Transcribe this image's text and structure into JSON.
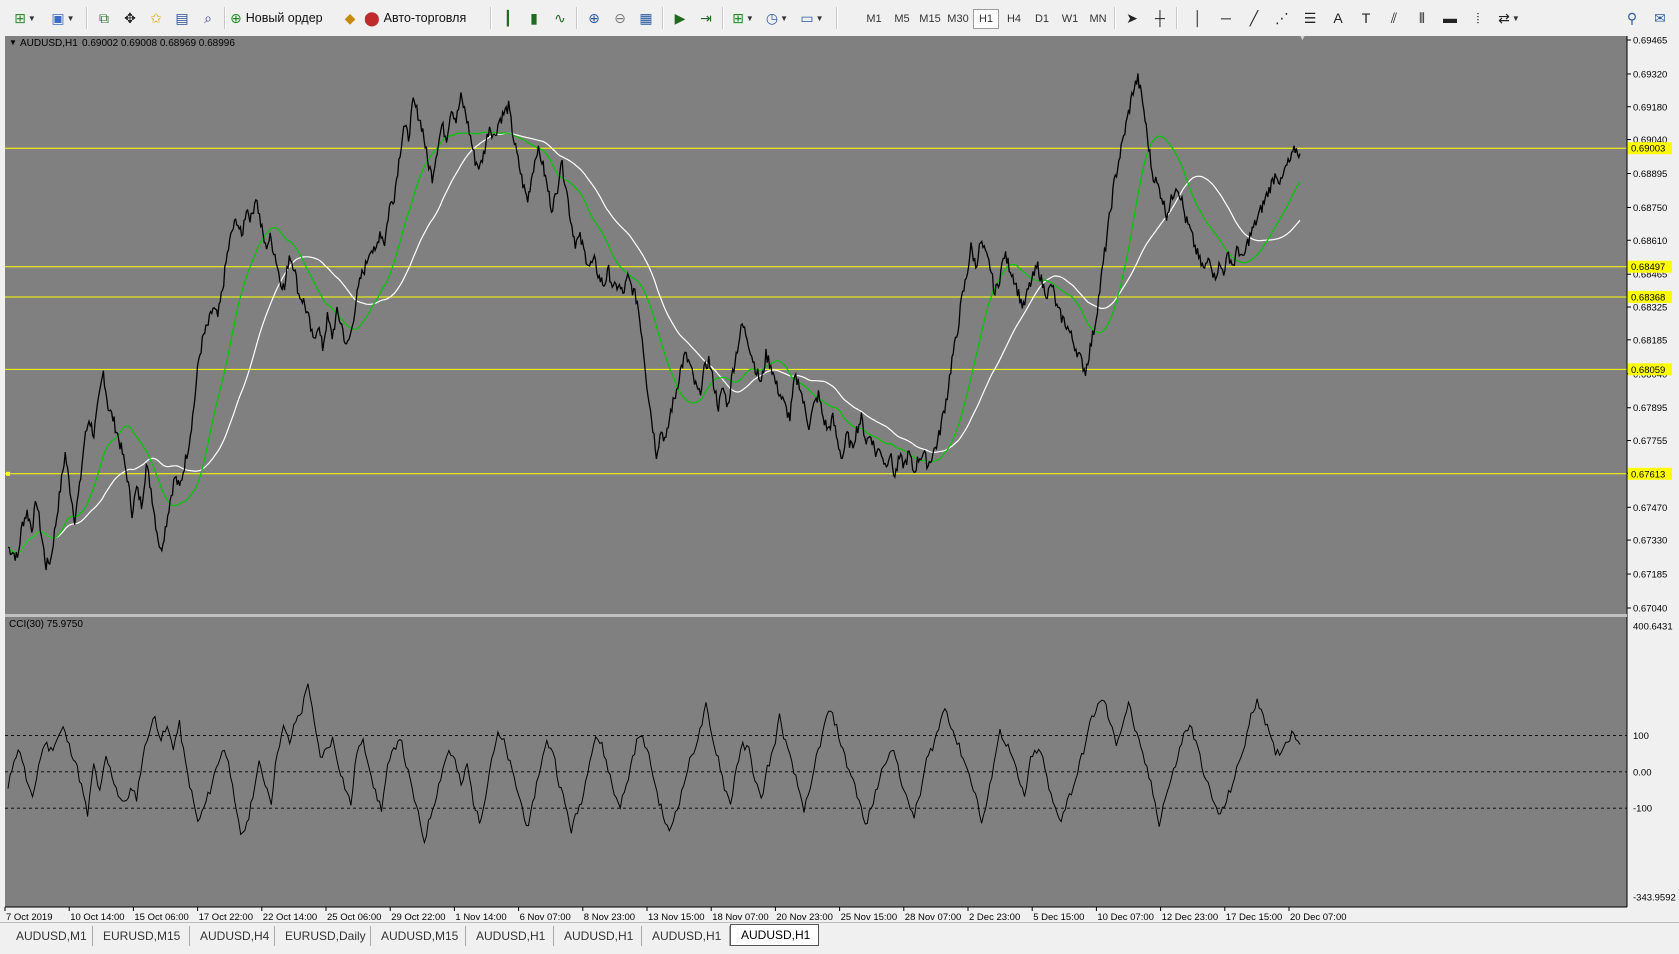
{
  "toolbar": {
    "new_order_label": "Новый ордер",
    "autotrading_label": "Авто-торговля",
    "timeframes": [
      "M1",
      "M5",
      "M15",
      "M30",
      "H1",
      "H4",
      "D1",
      "W1",
      "MN"
    ],
    "active_timeframe": "H1"
  },
  "chart": {
    "header_label": "AUDUSD,H1",
    "header_ohlc": "0.69002 0.69008 0.68969 0.68996",
    "indicator_label": "CCI(30) 75.9750",
    "colors": {
      "background": "#808080",
      "price": "#000000",
      "ma_fast": "#00c800",
      "ma_slow": "#ffffff",
      "level_line": "#ffff00",
      "level_label_bg": "#ffff00",
      "axis_text": "#000000"
    }
  },
  "chart_data": [
    {
      "type": "line",
      "title": "AUDUSD,H1",
      "ylim": [
        0.6704,
        0.69465
      ],
      "y_ticks": [
        "0.69465",
        "0.69320",
        "0.69180",
        "0.69040",
        "0.68895",
        "0.68750",
        "0.68610",
        "0.68465",
        "0.68325",
        "0.68185",
        "0.68040",
        "0.67895",
        "0.67755",
        "0.67615",
        "0.67470",
        "0.67330",
        "0.67185",
        "0.67040"
      ],
      "x_labels": [
        "7 Oct 2019",
        "10 Oct 14:00",
        "15 Oct 06:00",
        "17 Oct 22:00",
        "22 Oct 14:00",
        "25 Oct 06:00",
        "29 Oct 22:00",
        "1 Nov 14:00",
        "6 Nov 07:00",
        "8 Nov 23:00",
        "13 Nov 15:00",
        "18 Nov 07:00",
        "20 Nov 23:00",
        "25 Nov 15:00",
        "28 Nov 07:00",
        "2 Dec 23:00",
        "5 Dec 15:00",
        "10 Dec 07:00",
        "12 Dec 23:00",
        "17 Dec 15:00",
        "20 Dec 07:00"
      ],
      "horizontal_levels": [
        "0.69003",
        "0.68497",
        "0.68368",
        "0.68059",
        "0.67613"
      ],
      "series": [
        {
          "values": [
            0.673,
            0.6728,
            0.6725,
            0.674,
            0.6745,
            0.6738,
            0.675,
            0.6735,
            0.6722,
            0.6725,
            0.674,
            0.6755,
            0.677,
            0.6755,
            0.6742,
            0.6755,
            0.6775,
            0.6785,
            0.6778,
            0.6792,
            0.6805,
            0.679,
            0.6785,
            0.6778,
            0.677,
            0.676,
            0.6745,
            0.6755,
            0.6748,
            0.6765,
            0.6755,
            0.674,
            0.6728,
            0.6738,
            0.675,
            0.676,
            0.6755,
            0.6765,
            0.6775,
            0.679,
            0.681,
            0.682,
            0.6825,
            0.6832,
            0.6828,
            0.684,
            0.6855,
            0.6865,
            0.687,
            0.6862,
            0.6875,
            0.687,
            0.688,
            0.6868,
            0.6858,
            0.6862,
            0.6855,
            0.6845,
            0.684,
            0.6855,
            0.685,
            0.6838,
            0.6835,
            0.6828,
            0.6818,
            0.6825,
            0.6815,
            0.6828,
            0.682,
            0.683,
            0.6825,
            0.6815,
            0.6822,
            0.6835,
            0.6845,
            0.685,
            0.6858,
            0.6855,
            0.6865,
            0.686,
            0.6875,
            0.688,
            0.6895,
            0.691,
            0.6905,
            0.692,
            0.6915,
            0.6908,
            0.6895,
            0.6888,
            0.69,
            0.691,
            0.6905,
            0.6918,
            0.6912,
            0.6922,
            0.6915,
            0.6905,
            0.6895,
            0.6892,
            0.69,
            0.691,
            0.6905,
            0.6912,
            0.6915,
            0.6918,
            0.6905,
            0.6895,
            0.6885,
            0.6878,
            0.689,
            0.69,
            0.6895,
            0.6885,
            0.6875,
            0.688,
            0.6895,
            0.6885,
            0.687,
            0.686,
            0.6862,
            0.6855,
            0.685,
            0.6852,
            0.6845,
            0.6842,
            0.6848,
            0.684,
            0.6842,
            0.6838,
            0.6845,
            0.684,
            0.6835,
            0.682,
            0.68,
            0.6785,
            0.677,
            0.678,
            0.6775,
            0.6788,
            0.6795,
            0.6805,
            0.6812,
            0.6808,
            0.68,
            0.6795,
            0.6805,
            0.681,
            0.68,
            0.679,
            0.6798,
            0.679,
            0.6805,
            0.6815,
            0.6825,
            0.682,
            0.6812,
            0.6805,
            0.68,
            0.6812,
            0.6808,
            0.68,
            0.6795,
            0.679,
            0.6785,
            0.6802,
            0.68,
            0.679,
            0.6782,
            0.679,
            0.6795,
            0.6785,
            0.678,
            0.6785,
            0.6775,
            0.6768,
            0.6778,
            0.6772,
            0.678,
            0.6785,
            0.6775,
            0.6778,
            0.677,
            0.6772,
            0.6765,
            0.677,
            0.676,
            0.6768,
            0.6765,
            0.677,
            0.6762,
            0.6768,
            0.677,
            0.6765,
            0.677,
            0.6775,
            0.6785,
            0.6795,
            0.681,
            0.682,
            0.6835,
            0.6845,
            0.6858,
            0.685,
            0.686,
            0.6855,
            0.685,
            0.6838,
            0.6845,
            0.6855,
            0.685,
            0.6845,
            0.6838,
            0.6832,
            0.684,
            0.6845,
            0.685,
            0.6842,
            0.6838,
            0.6842,
            0.6832,
            0.6828,
            0.6825,
            0.682,
            0.6815,
            0.681,
            0.6805,
            0.6815,
            0.6825,
            0.684,
            0.6855,
            0.687,
            0.6885,
            0.6895,
            0.6905,
            0.6915,
            0.6925,
            0.693,
            0.692,
            0.6905,
            0.689,
            0.6885,
            0.688,
            0.6872,
            0.6878,
            0.6885,
            0.688,
            0.687,
            0.6865,
            0.6858,
            0.6852,
            0.6848,
            0.6855,
            0.6845,
            0.685,
            0.6848,
            0.6855,
            0.685,
            0.6858,
            0.6852,
            0.686,
            0.6865,
            0.687,
            0.6875,
            0.688,
            0.6885,
            0.689,
            0.6885,
            0.6892,
            0.6895,
            0.69,
            0.6898
          ]
        },
        {
          "name": "",
          "values": []
        }
      ]
    },
    {
      "type": "line",
      "title": "CCI(30) 75.9750",
      "ylim": [
        -343.9592,
        400.6431
      ],
      "y_ticks": [
        "400.6431",
        "100",
        "0.00",
        "-100",
        "-343.9592"
      ],
      "dashed_levels": [
        100,
        0,
        -100
      ],
      "series": [
        {
          "values": [
            -50,
            40,
            60,
            -20,
            -80,
            20,
            80,
            60,
            90,
            120,
            70,
            30,
            -40,
            -120,
            20,
            -60,
            40,
            -10,
            -60,
            -90,
            -50,
            -70,
            40,
            110,
            150,
            90,
            120,
            70,
            130,
            20,
            -60,
            -140,
            -100,
            -50,
            10,
            60,
            40,
            -90,
            -170,
            -150,
            -60,
            20,
            -30,
            -80,
            60,
            120,
            80,
            140,
            170,
            250,
            130,
            40,
            60,
            90,
            20,
            -40,
            -90,
            60,
            80,
            20,
            -60,
            -100,
            10,
            60,
            100,
            20,
            -50,
            -120,
            -190,
            -120,
            -60,
            10,
            60,
            30,
            -40,
            20,
            -80,
            -140,
            -60,
            40,
            100,
            80,
            20,
            -40,
            -100,
            -160,
            -60,
            20,
            80,
            60,
            -30,
            -90,
            -160,
            -110,
            -60,
            40,
            100,
            70,
            10,
            -60,
            -90,
            -40,
            40,
            100,
            80,
            20,
            -60,
            -120,
            -170,
            -110,
            -60,
            10,
            60,
            110,
            180,
            90,
            40,
            -40,
            -90,
            20,
            70,
            60,
            -20,
            -80,
            10,
            60,
            150,
            80,
            20,
            -40,
            -100,
            -60,
            40,
            100,
            170,
            140,
            80,
            20,
            -20,
            -80,
            -150,
            -100,
            -40,
            20,
            60,
            40,
            -30,
            -90,
            -120,
            -60,
            30,
            70,
            120,
            180,
            130,
            80,
            40,
            -10,
            -60,
            -140,
            -80,
            30,
            110,
            80,
            40,
            -20,
            -70,
            30,
            60,
            40,
            -50,
            -100,
            -130,
            -80,
            -40,
            20,
            80,
            150,
            180,
            200,
            130,
            80,
            130,
            190,
            120,
            60,
            10,
            -60,
            -140,
            -70,
            -20,
            40,
            100,
            130,
            80,
            20,
            -40,
            -90,
            -120,
            -80,
            -30,
            20,
            80,
            150,
            200,
            160,
            100,
            50,
            60,
            90,
            110,
            75
          ]
        }
      ]
    }
  ],
  "tabs": [
    {
      "label": "AUDUSD,M1",
      "active": false
    },
    {
      "label": "EURUSD,M15",
      "active": false
    },
    {
      "label": "AUDUSD,H4",
      "active": false
    },
    {
      "label": "EURUSD,Daily",
      "active": false
    },
    {
      "label": "AUDUSD,M15",
      "active": false
    },
    {
      "label": "AUDUSD,H1",
      "active": false
    },
    {
      "label": "AUDUSD,H1",
      "active": false
    },
    {
      "label": "AUDUSD,H1",
      "active": false
    },
    {
      "label": "AUDUSD,H1",
      "active": true
    }
  ]
}
